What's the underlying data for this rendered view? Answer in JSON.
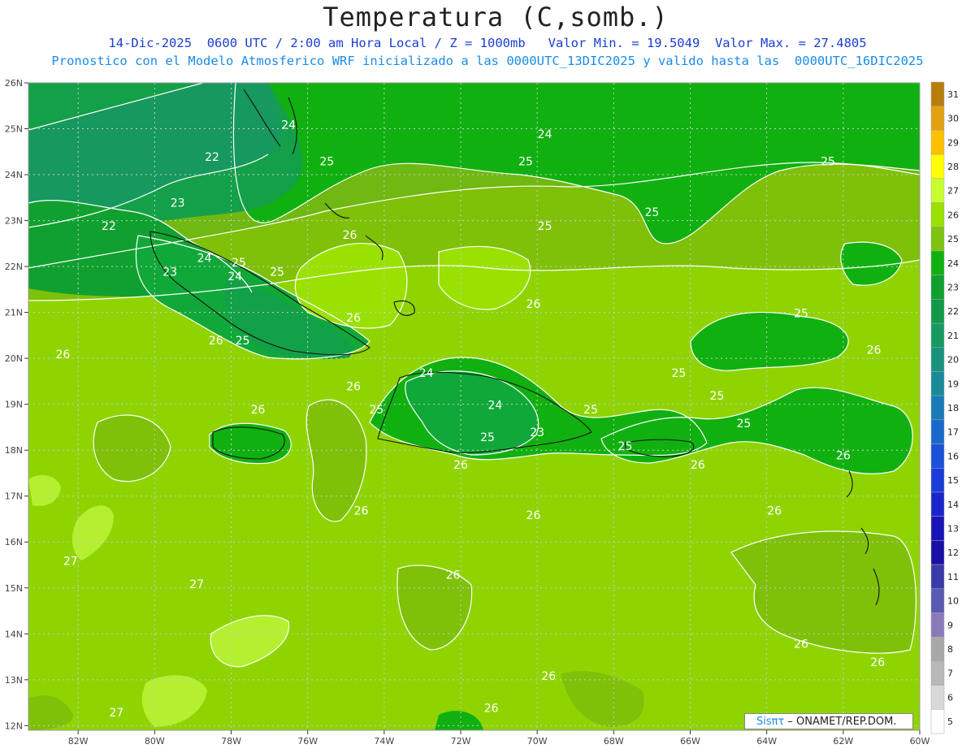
{
  "title": "Temperatura (C,somb.)",
  "subtitle_line1": "14-Dic-2025  0600 UTC / 2:00 am Hora Local / Z = 1000mb   Valor Min. = 19.5049  Valor Max. = 27.4805",
  "subtitle_line2": "Pronostico con el Modelo Atmosferico WRF inicializado a las 0000UTC_13DIC2025 y valido hasta las  0000UTC_16DIC2025",
  "credit": {
    "brand": "Sisπτ",
    "text": " – ONAMET/REP.DOM."
  },
  "lat_labels": [
    "26N",
    "25N",
    "24N",
    "23N",
    "22N",
    "21N",
    "20N",
    "19N",
    "18N",
    "17N",
    "16N",
    "15N",
    "14N",
    "13N",
    "12N"
  ],
  "lon_labels": [
    "82W",
    "80W",
    "78W",
    "76W",
    "74W",
    "72W",
    "70W",
    "68W",
    "66W",
    "64W",
    "62W",
    "60W"
  ],
  "colorbar": {
    "labels": [
      "31",
      "30",
      "29",
      "28",
      "27",
      "26",
      "25",
      "24",
      "23",
      "22",
      "21",
      "20",
      "19",
      "18",
      "17",
      "16",
      "15",
      "14",
      "13",
      "12",
      "11",
      "10",
      "9",
      "8",
      "7",
      "6",
      "5"
    ],
    "colors": [
      "#b87e0a",
      "#e3a010",
      "#ffc000",
      "#ffff00",
      "#c8ff30",
      "#9ae000",
      "#7cc410",
      "#10b010",
      "#10a030",
      "#109a48",
      "#169a62",
      "#18947e",
      "#1a8a98",
      "#1a7ab8",
      "#1a68cc",
      "#1a52d8",
      "#1a3cd8",
      "#1a26cc",
      "#1a14b8",
      "#1a10a6",
      "#3a3aa8",
      "#5a5ab4",
      "#8a7ab8",
      "#a8a8a8",
      "#b8b8b8",
      "#d8d8d8",
      "#ffffff"
    ]
  },
  "contour_labels": [
    {
      "text": "24",
      "lon": -76.5,
      "lat": 25.0
    },
    {
      "text": "22",
      "lon": -78.5,
      "lat": 24.3
    },
    {
      "text": "23",
      "lon": -79.4,
      "lat": 23.3
    },
    {
      "text": "22",
      "lon": -81.2,
      "lat": 22.8
    },
    {
      "text": "24",
      "lon": -78.7,
      "lat": 22.1
    },
    {
      "text": "23",
      "lon": -79.6,
      "lat": 21.8
    },
    {
      "text": "25",
      "lon": -77.8,
      "lat": 22.0
    },
    {
      "text": "24",
      "lon": -77.9,
      "lat": 21.7
    },
    {
      "text": "25",
      "lon": -76.8,
      "lat": 21.8
    },
    {
      "text": "25",
      "lon": -75.5,
      "lat": 24.2
    },
    {
      "text": "26",
      "lon": -74.9,
      "lat": 22.6
    },
    {
      "text": "25",
      "lon": -70.3,
      "lat": 24.2
    },
    {
      "text": "24",
      "lon": -69.8,
      "lat": 24.8
    },
    {
      "text": "25",
      "lon": -69.8,
      "lat": 22.8
    },
    {
      "text": "25",
      "lon": -67.0,
      "lat": 23.1
    },
    {
      "text": "25",
      "lon": -62.4,
      "lat": 24.2
    },
    {
      "text": "26",
      "lon": -74.8,
      "lat": 20.8
    },
    {
      "text": "26",
      "lon": -78.4,
      "lat": 20.3
    },
    {
      "text": "25",
      "lon": -77.7,
      "lat": 20.3
    },
    {
      "text": "26",
      "lon": -82.4,
      "lat": 20.0
    },
    {
      "text": "26",
      "lon": -70.1,
      "lat": 21.1
    },
    {
      "text": "25",
      "lon": -63.1,
      "lat": 20.9
    },
    {
      "text": "26",
      "lon": -61.2,
      "lat": 20.1
    },
    {
      "text": "24",
      "lon": -72.9,
      "lat": 19.6
    },
    {
      "text": "25",
      "lon": -66.3,
      "lat": 19.6
    },
    {
      "text": "25",
      "lon": -65.3,
      "lat": 19.1
    },
    {
      "text": "26",
      "lon": -74.8,
      "lat": 19.3
    },
    {
      "text": "26",
      "lon": -77.3,
      "lat": 18.8
    },
    {
      "text": "25",
      "lon": -74.2,
      "lat": 18.8
    },
    {
      "text": "24",
      "lon": -71.1,
      "lat": 18.9
    },
    {
      "text": "25",
      "lon": -68.6,
      "lat": 18.8
    },
    {
      "text": "25",
      "lon": -64.6,
      "lat": 18.5
    },
    {
      "text": "25",
      "lon": -71.3,
      "lat": 18.2
    },
    {
      "text": "23",
      "lon": -70.0,
      "lat": 18.3
    },
    {
      "text": "25",
      "lon": -67.7,
      "lat": 18.0
    },
    {
      "text": "26",
      "lon": -72.0,
      "lat": 17.6
    },
    {
      "text": "26",
      "lon": -65.8,
      "lat": 17.6
    },
    {
      "text": "26",
      "lon": -62.0,
      "lat": 17.8
    },
    {
      "text": "26",
      "lon": -74.6,
      "lat": 16.6
    },
    {
      "text": "26",
      "lon": -70.1,
      "lat": 16.5
    },
    {
      "text": "26",
      "lon": -63.8,
      "lat": 16.6
    },
    {
      "text": "27",
      "lon": -82.2,
      "lat": 15.5
    },
    {
      "text": "27",
      "lon": -78.9,
      "lat": 15.0
    },
    {
      "text": "26",
      "lon": -72.2,
      "lat": 15.2
    },
    {
      "text": "26",
      "lon": -63.1,
      "lat": 13.7
    },
    {
      "text": "26",
      "lon": -61.1,
      "lat": 13.3
    },
    {
      "text": "26",
      "lon": -69.7,
      "lat": 13.0
    },
    {
      "text": "27",
      "lon": -81.0,
      "lat": 12.2
    },
    {
      "text": "26",
      "lon": -71.2,
      "lat": 12.3
    }
  ]
}
